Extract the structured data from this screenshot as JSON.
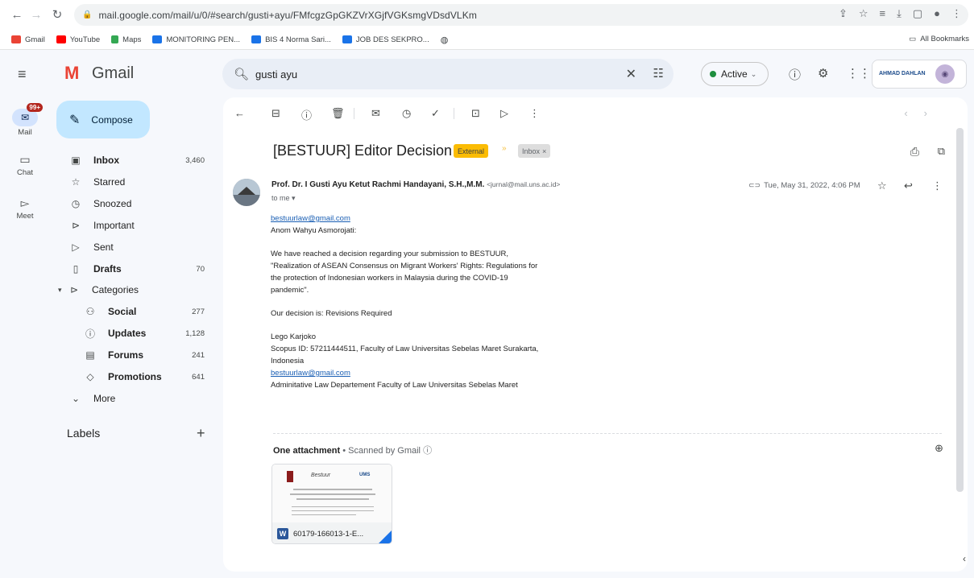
{
  "browser": {
    "url": "mail.google.com/mail/u/0/#search/gusti+ayu/FMfcgzGpGKZVrXGjfVGKsmgVDsdVLKm",
    "bookmarks": [
      "Gmail",
      "YouTube",
      "Maps",
      "MONITORING PEN...",
      "BIS 4 Norma Sari...",
      "JOB DES SEKPRO..."
    ],
    "all_bookmarks": "All Bookmarks"
  },
  "app": {
    "logo_text": "Gmail",
    "account_org": "AHMAD DAHLAN"
  },
  "search": {
    "value": "gusti ayu"
  },
  "status": {
    "label": "Active"
  },
  "rail": {
    "mail": "Mail",
    "mail_badge": "99+",
    "chat": "Chat",
    "meet": "Meet"
  },
  "compose": {
    "label": "Compose"
  },
  "nav": [
    {
      "label": "Inbox",
      "count": "3,460",
      "bold": true
    },
    {
      "label": "Starred",
      "count": ""
    },
    {
      "label": "Snoozed",
      "count": ""
    },
    {
      "label": "Important",
      "count": ""
    },
    {
      "label": "Sent",
      "count": ""
    },
    {
      "label": "Drafts",
      "count": "70",
      "bold": true
    },
    {
      "label": "Categories",
      "count": ""
    },
    {
      "label": "Social",
      "count": "277",
      "bold": true
    },
    {
      "label": "Updates",
      "count": "1,128",
      "bold": true
    },
    {
      "label": "Forums",
      "count": "241",
      "bold": true
    },
    {
      "label": "Promotions",
      "count": "641",
      "bold": true
    },
    {
      "label": "More",
      "count": ""
    }
  ],
  "labels": {
    "title": "Labels"
  },
  "email": {
    "subject": "[BESTUUR] Editor Decision",
    "tag_external": "External",
    "tag_inbox": "Inbox",
    "sender_name": "Prof. Dr. I Gusti Ayu Ketut Rachmi Handayani, S.H.,M.M.",
    "sender_email": "<jurnal@mail.uns.ac.id>",
    "to": "to me",
    "date": "Tue, May 31, 2022, 4:06 PM",
    "body": {
      "recipient_email": "bestuurlaw@gmail.com",
      "recipient_name": "Anom Wahyu Asmorojati:",
      "p1_line1": "We have reached a decision regarding your submission to BESTUUR,",
      "p1_line2": "\"Realization of ASEAN Consensus on Migrant Workers' Rights: Regulations for",
      "p1_line3": "the protection of Indonesian workers in Malaysia during the COVID-19",
      "p1_line4": "pandemic\".",
      "decision": "Our decision is: Revisions Required",
      "sig_name": "Lego Karjoko",
      "sig_line1": "Scopus ID: 57211444511, Faculty of Law Universitas Sebelas Maret Surakarta,",
      "sig_line2": "Indonesia",
      "sig_email": "bestuurlaw@gmail.com",
      "sig_dept": "Adminitative Law Departement Faculty of Law Universitas Sebelas Maret"
    },
    "attachment": {
      "title": "One attachment",
      "scanned": "Scanned by Gmail",
      "filename": "60179-166013-1-E...",
      "preview_logo": "Bestuur",
      "preview_right": "UMS"
    }
  }
}
